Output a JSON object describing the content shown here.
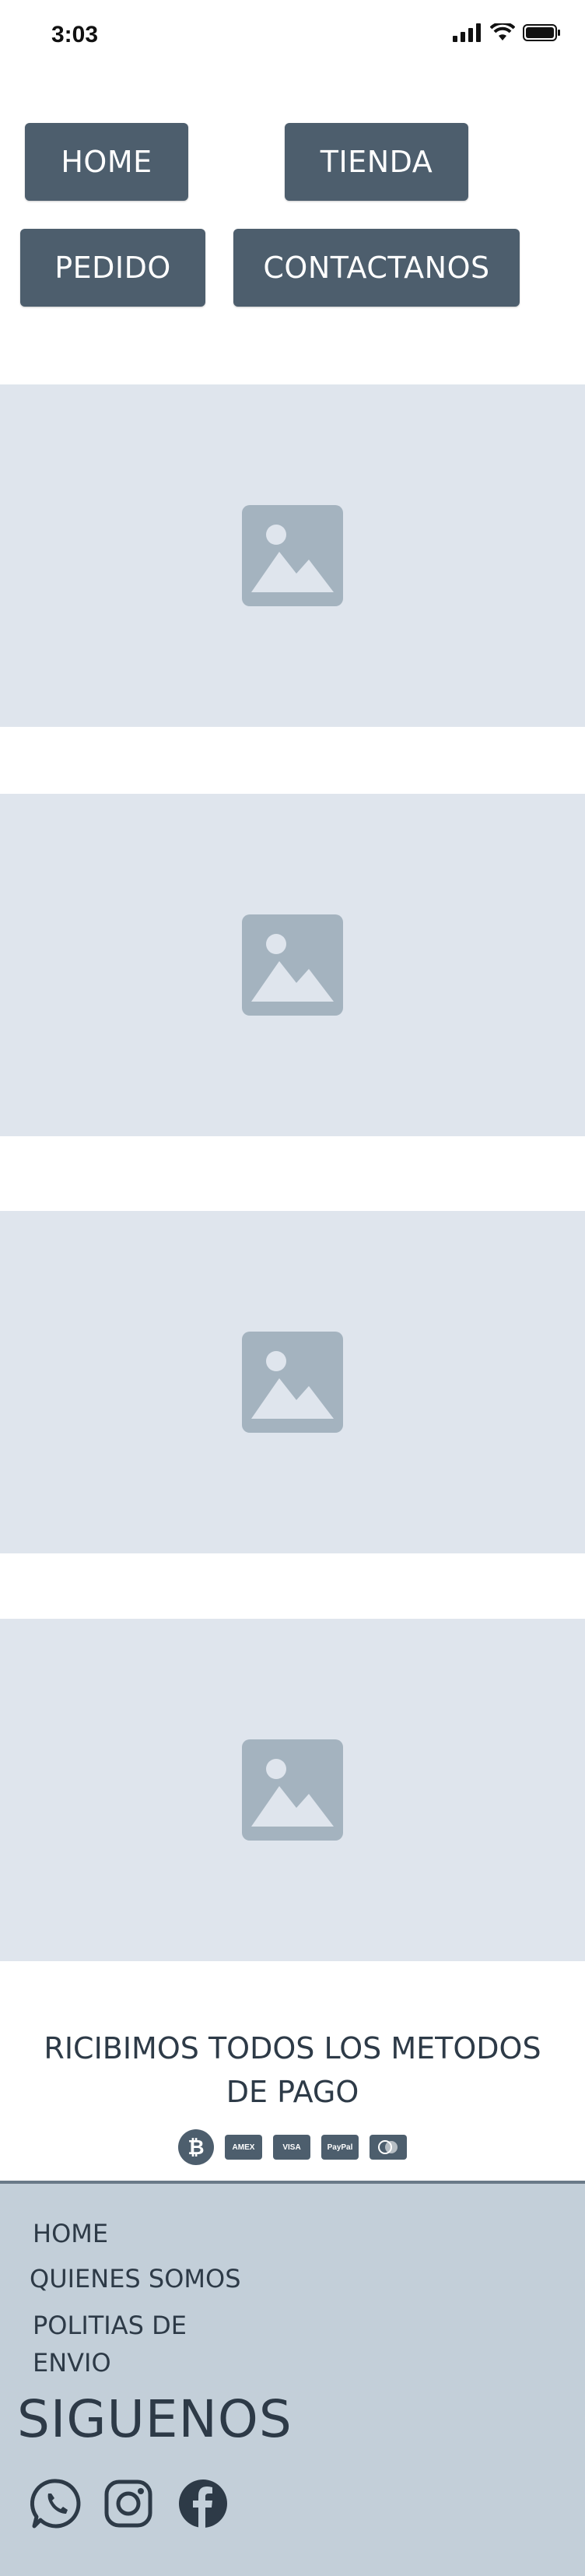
{
  "status_bar": {
    "time": "3:03"
  },
  "nav": {
    "home": "HOME",
    "tienda": "TIENDA",
    "pedido": "PEDIDO",
    "contactanos": "CONTACTANOS"
  },
  "payment": {
    "title": "RICIBIMOS TODOS LOS METODOS DE PAGO",
    "methods": [
      "bitcoin-icon",
      "amex-icon",
      "visa-icon",
      "paypal-icon",
      "mastercard-icon"
    ],
    "amex_label": "AMEX",
    "visa_label": "VISA",
    "paypal_label": "PayPal",
    "btc_label": "₿"
  },
  "footer": {
    "links": [
      "HOME",
      "QUIENES SOMOS",
      "POLITIAS DE ENVIO"
    ],
    "follow_title": "SIGUENOS",
    "social": [
      "whatsapp-icon",
      "instagram-icon",
      "facebook-icon"
    ]
  },
  "colors": {
    "button_bg": "#4d5e6d",
    "placeholder_bg": "#dfe5ed",
    "placeholder_icon": "#a4b3bf",
    "footer_bg": "#c3cfd9",
    "text_dark": "#2d3a47"
  }
}
